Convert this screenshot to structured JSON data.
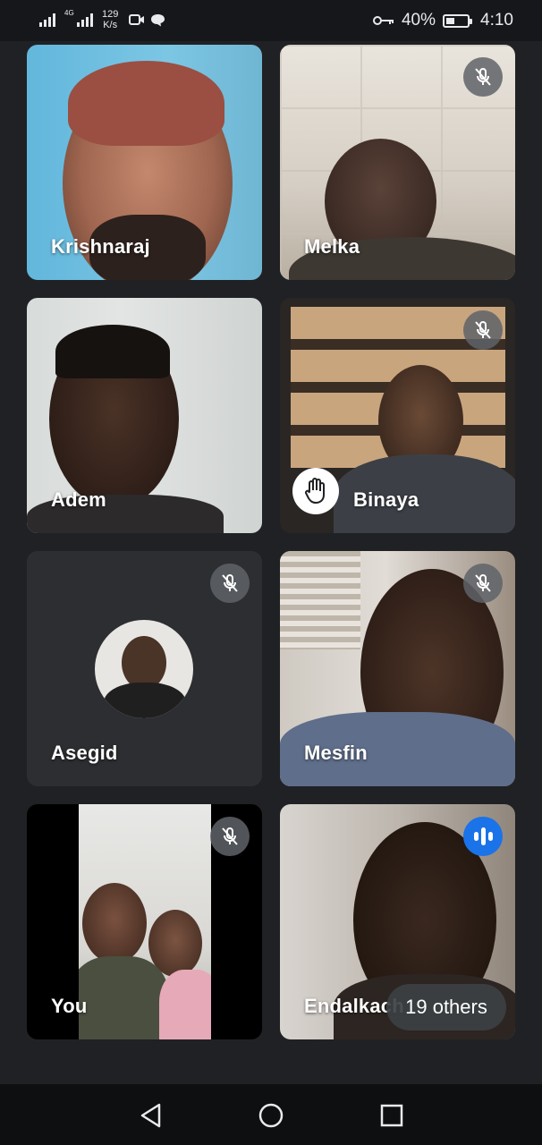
{
  "status_bar": {
    "network_left": "4G",
    "speed_value": "129",
    "speed_unit": "K/s",
    "battery_percent": "40%",
    "battery_level": 0.4,
    "time": "4:10",
    "icons": [
      "signal-icon",
      "signal-4g-icon",
      "video-icon",
      "chat-icon",
      "key-icon",
      "battery-icon"
    ]
  },
  "participants": [
    {
      "name": "Krishnaraj",
      "muted": false,
      "speaking": false,
      "hand_raised": false
    },
    {
      "name": "Melka",
      "muted": true,
      "speaking": false,
      "hand_raised": false
    },
    {
      "name": "Adem",
      "muted": false,
      "speaking": false,
      "hand_raised": false
    },
    {
      "name": "Binaya",
      "muted": true,
      "speaking": false,
      "hand_raised": true
    },
    {
      "name": "Asegid",
      "muted": true,
      "speaking": false,
      "hand_raised": false,
      "camera_off": true
    },
    {
      "name": "Mesfin",
      "muted": true,
      "speaking": false,
      "hand_raised": false
    },
    {
      "name": "You",
      "muted": true,
      "speaking": false,
      "hand_raised": false
    },
    {
      "name": "Endalkach",
      "muted": false,
      "speaking": true,
      "hand_raised": false
    }
  ],
  "others_label": "19 others",
  "colors": {
    "speaking": "#1a73e8",
    "background": "#202124",
    "tile_off": "#2d2e31"
  },
  "nav_icons": [
    "back-icon",
    "home-icon",
    "recents-icon"
  ]
}
